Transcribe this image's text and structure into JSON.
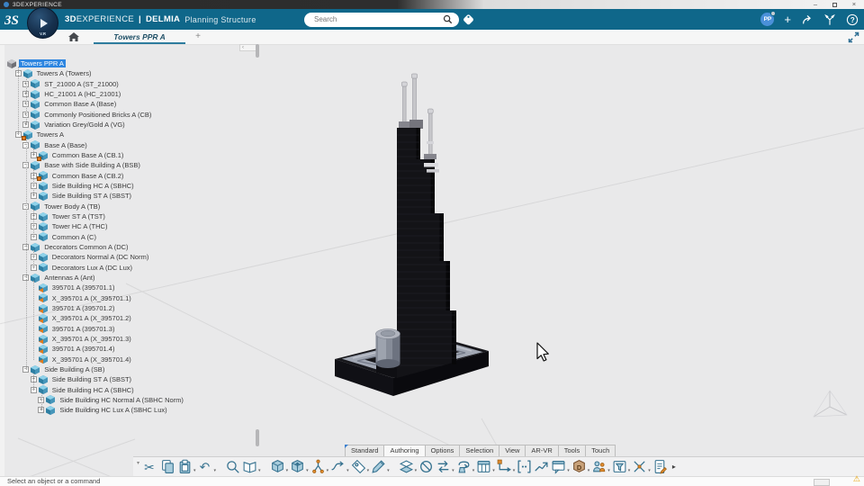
{
  "window": {
    "app_title": "3DEXPERIENCE",
    "minimize": "–",
    "close": "×"
  },
  "header": {
    "brand_bold": "3D",
    "brand_light": "EXPERIENCE",
    "divider": "|",
    "app_bold": "DELMIA",
    "app_sub": "Planning Structure",
    "compass_label": "V.R",
    "user_initials": "PP",
    "plus": "+",
    "teal": "#0f678a",
    "accent_blue": "#3a7fd0"
  },
  "search": {
    "placeholder": "Search"
  },
  "tabbar": {
    "active_tab": "Towers PPR A",
    "new_tab": "+"
  },
  "tree": {
    "items": [
      {
        "label": "Towers PPR A",
        "level": 0,
        "exp": "",
        "icon": "root",
        "selected": true
      },
      {
        "label": "Towers A (Towers)",
        "level": 1,
        "exp": "-",
        "icon": "node"
      },
      {
        "label": "ST_21000 A (ST_21000)",
        "level": 2,
        "exp": "+",
        "icon": "node"
      },
      {
        "label": "HC_21001 A (HC_21001)",
        "level": 2,
        "exp": "+",
        "icon": "node"
      },
      {
        "label": "Common Base A (Base)",
        "level": 2,
        "exp": "+",
        "icon": "node"
      },
      {
        "label": "Commonly Positioned Bricks A (CB)",
        "level": 2,
        "exp": "+",
        "icon": "node"
      },
      {
        "label": "Variation Grey/Gold A (VG)",
        "level": 2,
        "exp": "+",
        "icon": "node"
      },
      {
        "label": "Towers A",
        "level": 1,
        "exp": "-",
        "icon": "node",
        "mark": true
      },
      {
        "label": "Base A (Base)",
        "level": 2,
        "exp": "-",
        "icon": "node"
      },
      {
        "label": "Common Base A (CB.1)",
        "level": 3,
        "exp": "+",
        "icon": "node",
        "mark": true
      },
      {
        "label": "Base with Side Building A (BSB)",
        "level": 2,
        "exp": "-",
        "icon": "node"
      },
      {
        "label": "Common Base A (CB.2)",
        "level": 3,
        "exp": "+",
        "icon": "node",
        "mark": true
      },
      {
        "label": "Side Building HC A (SBHC)",
        "level": 3,
        "exp": "+",
        "icon": "node"
      },
      {
        "label": "Side Building ST A (SBST)",
        "level": 3,
        "exp": "+",
        "icon": "node"
      },
      {
        "label": "Tower Body A (TB)",
        "level": 2,
        "exp": "-",
        "icon": "node"
      },
      {
        "label": "Tower ST A (TST)",
        "level": 3,
        "exp": "+",
        "icon": "node"
      },
      {
        "label": "Tower HC A (THC)",
        "level": 3,
        "exp": "+",
        "icon": "node"
      },
      {
        "label": "Common A (C)",
        "level": 3,
        "exp": "+",
        "icon": "node"
      },
      {
        "label": "Decorators Common A (DC)",
        "level": 2,
        "exp": "-",
        "icon": "node"
      },
      {
        "label": "Decorators Normal A (DC Norm)",
        "level": 3,
        "exp": "+",
        "icon": "node"
      },
      {
        "label": "Decorators Lux A (DC Lux)",
        "level": 3,
        "exp": "+",
        "icon": "node"
      },
      {
        "label": "Antennas A (Ant)",
        "level": 2,
        "exp": "-",
        "icon": "node"
      },
      {
        "label": "395701 A (395701.1)",
        "level": 3,
        "exp": "",
        "icon": "res"
      },
      {
        "label": "X_395701 A (X_395701.1)",
        "level": 3,
        "exp": "",
        "icon": "res"
      },
      {
        "label": "395701 A (395701.2)",
        "level": 3,
        "exp": "",
        "icon": "res"
      },
      {
        "label": "X_395701 A (X_395701.2)",
        "level": 3,
        "exp": "",
        "icon": "res"
      },
      {
        "label": "395701 A (395701.3)",
        "level": 3,
        "exp": "",
        "icon": "res"
      },
      {
        "label": "X_395701 A (X_395701.3)",
        "level": 3,
        "exp": "",
        "icon": "res"
      },
      {
        "label": "395701 A (395701.4)",
        "level": 3,
        "exp": "",
        "icon": "res"
      },
      {
        "label": "X_395701 A (X_395701.4)",
        "level": 3,
        "exp": "",
        "icon": "res"
      },
      {
        "label": "Side Building A (SB)",
        "level": 2,
        "exp": "-",
        "icon": "node"
      },
      {
        "label": "Side Building ST A (SBST)",
        "level": 3,
        "exp": "+",
        "icon": "node"
      },
      {
        "label": "Side Building HC A (SBHC)",
        "level": 3,
        "exp": "-",
        "icon": "node"
      },
      {
        "label": "Side Building HC Normal A (SBHC Norm)",
        "level": 4,
        "exp": "+",
        "icon": "node"
      },
      {
        "label": "Side Building HC Lux A (SBHC Lux)",
        "level": 4,
        "exp": "+",
        "icon": "node"
      }
    ]
  },
  "ribbon": {
    "tabs": [
      {
        "label": "Standard"
      },
      {
        "label": "Authoring",
        "active": true
      },
      {
        "label": "Options"
      },
      {
        "label": "Selection"
      },
      {
        "label": "View"
      },
      {
        "label": "AR-VR"
      },
      {
        "label": "Tools"
      },
      {
        "label": "Touch"
      }
    ],
    "tools": [
      {
        "name": "cut",
        "dd": false
      },
      {
        "name": "copy",
        "dd": false
      },
      {
        "name": "paste",
        "dd": true
      },
      {
        "name": "undo",
        "dd": true,
        "gap": false
      },
      {
        "name": "search",
        "dd": false,
        "gap": true
      },
      {
        "name": "catalog",
        "dd": true
      },
      {
        "name": "product-cube",
        "dd": true,
        "gap": true
      },
      {
        "name": "insert-existing",
        "dd": true
      },
      {
        "name": "graph",
        "dd": true
      },
      {
        "name": "flow",
        "dd": true
      },
      {
        "name": "link",
        "dd": true
      },
      {
        "name": "edit",
        "dd": true
      },
      {
        "name": "layers",
        "dd": true,
        "gap": true
      },
      {
        "name": "no-entry",
        "dd": false
      },
      {
        "name": "swap",
        "dd": true
      },
      {
        "name": "loop",
        "dd": true
      },
      {
        "name": "table-window",
        "dd": true
      },
      {
        "name": "connector",
        "dd": true
      },
      {
        "name": "brackets",
        "dd": false
      },
      {
        "name": "sequence",
        "dd": false
      },
      {
        "name": "chat-window",
        "dd": true
      },
      {
        "name": "cube-d",
        "dd": true
      },
      {
        "name": "people",
        "dd": true
      },
      {
        "name": "filter",
        "dd": true
      },
      {
        "name": "tools-x",
        "dd": true
      },
      {
        "name": "report",
        "dd": false
      }
    ],
    "overflow": "▸",
    "collapse": "▾"
  },
  "statusbar": {
    "message": "Select an object or a command"
  }
}
